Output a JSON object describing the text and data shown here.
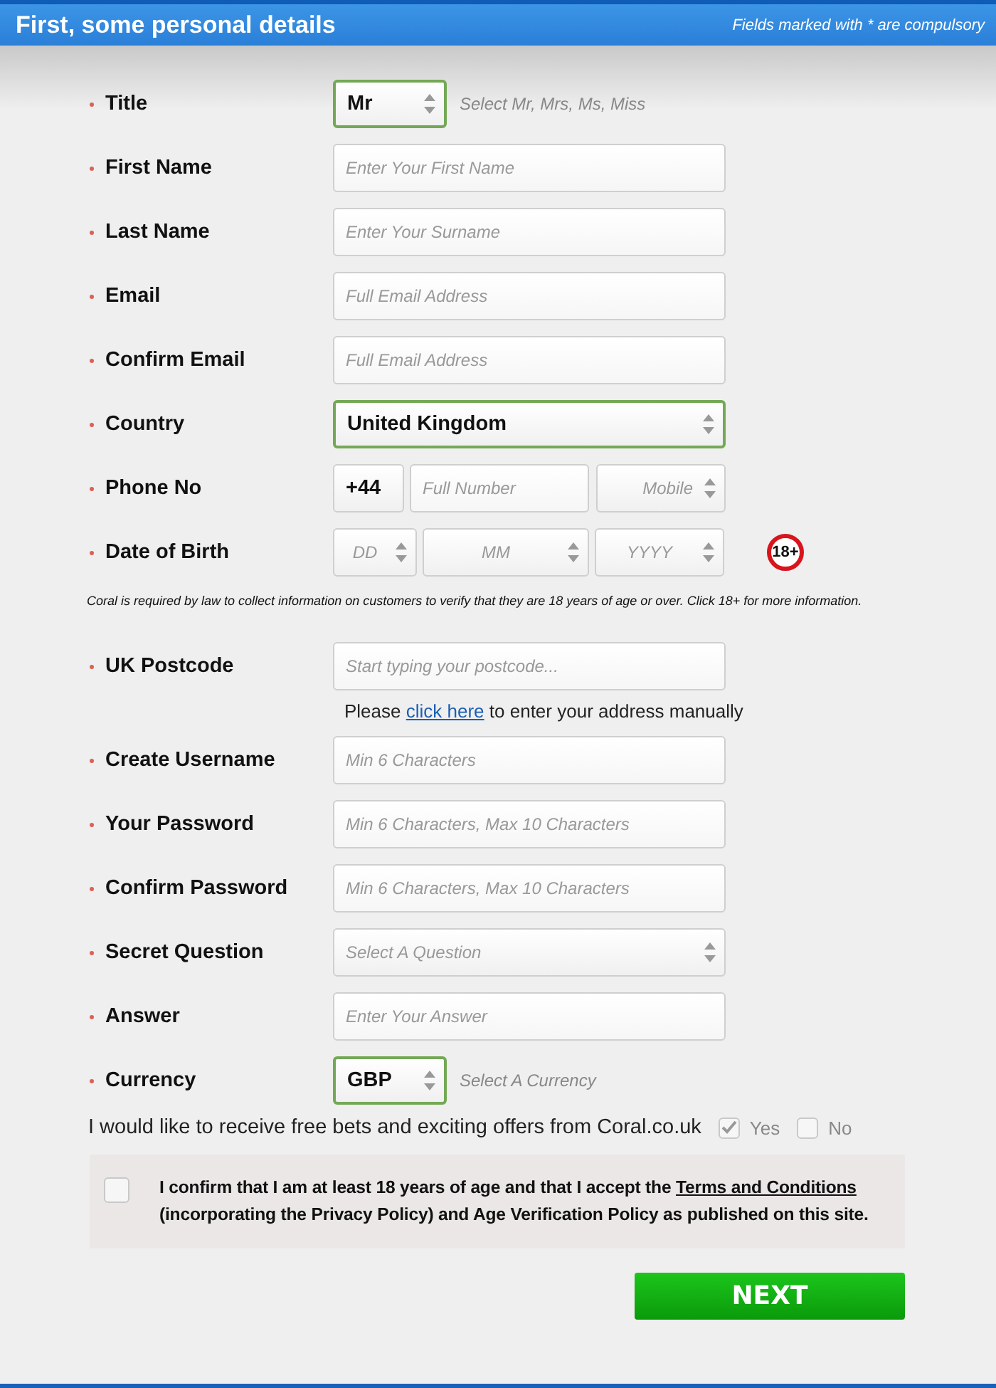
{
  "header": {
    "title": "First, some personal details",
    "note": "Fields marked with * are compulsory"
  },
  "rows": [
    {
      "kind": "short-select",
      "label": "Title",
      "value": "Mr",
      "valid": true,
      "hint": "Select Mr, Mrs, Ms, Miss"
    },
    {
      "kind": "text",
      "label": "First Name",
      "placeholder": "Enter Your First Name"
    },
    {
      "kind": "text",
      "label": "Last Name",
      "placeholder": "Enter Your Surname"
    },
    {
      "kind": "text",
      "label": "Email",
      "placeholder": "Full Email Address"
    },
    {
      "kind": "text",
      "label": "Confirm Email",
      "placeholder": "Full Email Address"
    },
    {
      "kind": "select",
      "label": "Country",
      "value": "United Kingdom",
      "valid": true
    },
    {
      "kind": "phone",
      "label": "Phone No",
      "prefix": "+44",
      "placeholder": "Full Number",
      "type_placeholder": "Mobile"
    },
    {
      "kind": "dob",
      "label": "Date of Birth",
      "parts": [
        "DD",
        "MM",
        "YYYY"
      ],
      "badge": "18+"
    },
    {
      "kind": "note",
      "text": "Coral is required by law to collect information on customers to verify that they are 18 years of age or over. Click 18+ for more information."
    },
    {
      "kind": "text",
      "label": "UK Postcode",
      "placeholder": "Start typing your postcode..."
    },
    {
      "kind": "helper",
      "before": "Please ",
      "link": "click here",
      "after": " to enter your address manually"
    },
    {
      "kind": "text",
      "label": "Create Username",
      "placeholder": "Min 6 Characters"
    },
    {
      "kind": "text",
      "label": "Your Password",
      "placeholder": "Min 6 Characters, Max 10 Characters"
    },
    {
      "kind": "text",
      "label": "Confirm Password",
      "placeholder": "Min 6 Characters, Max 10 Characters"
    },
    {
      "kind": "select",
      "label": "Secret Question",
      "placeholder": "Select A Question",
      "valid": false
    },
    {
      "kind": "text",
      "label": "Answer",
      "placeholder": "Enter Your Answer"
    },
    {
      "kind": "short-select",
      "label": "Currency",
      "value": "GBP",
      "valid": true,
      "hint": "Select A Currency"
    }
  ],
  "offers": {
    "text": "I would like to receive free bets and exciting offers from Coral.co.uk",
    "options": [
      {
        "label": "Yes",
        "checked": true
      },
      {
        "label": "No",
        "checked": false
      }
    ]
  },
  "consent": {
    "checked": false,
    "before": "I confirm that I am at least 18 years of age and that I accept the ",
    "link": "Terms and Conditions",
    "after": " (incorporating the Privacy Policy) and Age Verification Policy as published on this site."
  },
  "next_button": "NEXT"
}
